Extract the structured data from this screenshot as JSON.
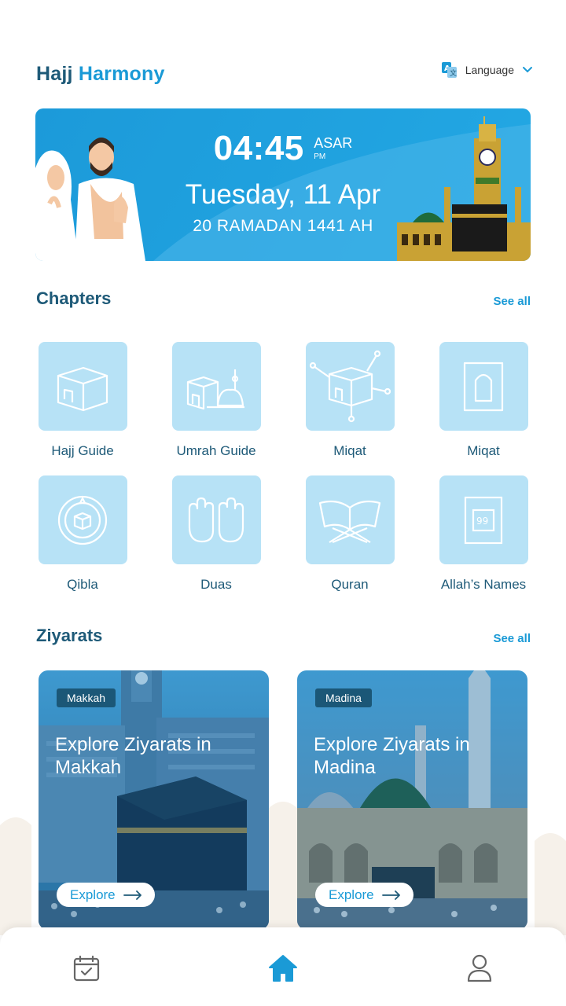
{
  "header": {
    "brand_part1": "Hajj",
    "brand_part2": "Harmony",
    "language_label": "Language"
  },
  "banner": {
    "time": "04:45",
    "prayer": "ASAR",
    "ampm": "PM",
    "date": "Tuesday, 11 Apr",
    "hijri": "20 RAMADAN 1441 AH"
  },
  "chapters": {
    "title": "Chapters",
    "see_all": "See all",
    "items": [
      {
        "label": "Hajj Guide",
        "icon": "kaaba-icon"
      },
      {
        "label": "Umrah Guide",
        "icon": "mosque-icon"
      },
      {
        "label": "Miqat",
        "icon": "miqat-network-icon"
      },
      {
        "label": "Miqat",
        "icon": "mihrab-icon"
      },
      {
        "label": "Qibla",
        "icon": "compass-icon"
      },
      {
        "label": "Duas",
        "icon": "praying-hands-icon"
      },
      {
        "label": "Quran",
        "icon": "quran-icon"
      },
      {
        "label": "Allah’s Names",
        "icon": "names-99-icon"
      }
    ]
  },
  "ziyarats": {
    "title": "Ziyarats",
    "see_all": "See all",
    "cards": [
      {
        "tag": "Makkah",
        "title": "Explore Ziyarats in Makkah",
        "button": "Explore"
      },
      {
        "tag": "Madina",
        "title": "Explore Ziyarats in Madina",
        "button": "Explore"
      }
    ]
  },
  "bottom_nav": [
    {
      "icon": "calendar-check-icon",
      "active": false
    },
    {
      "icon": "home-icon",
      "active": true
    },
    {
      "icon": "profile-icon",
      "active": false
    }
  ],
  "colors": {
    "primary_dark": "#1e5a78",
    "accent": "#1a9ad6",
    "tile": "#b7e2f6",
    "banner": "#23a8e4"
  }
}
